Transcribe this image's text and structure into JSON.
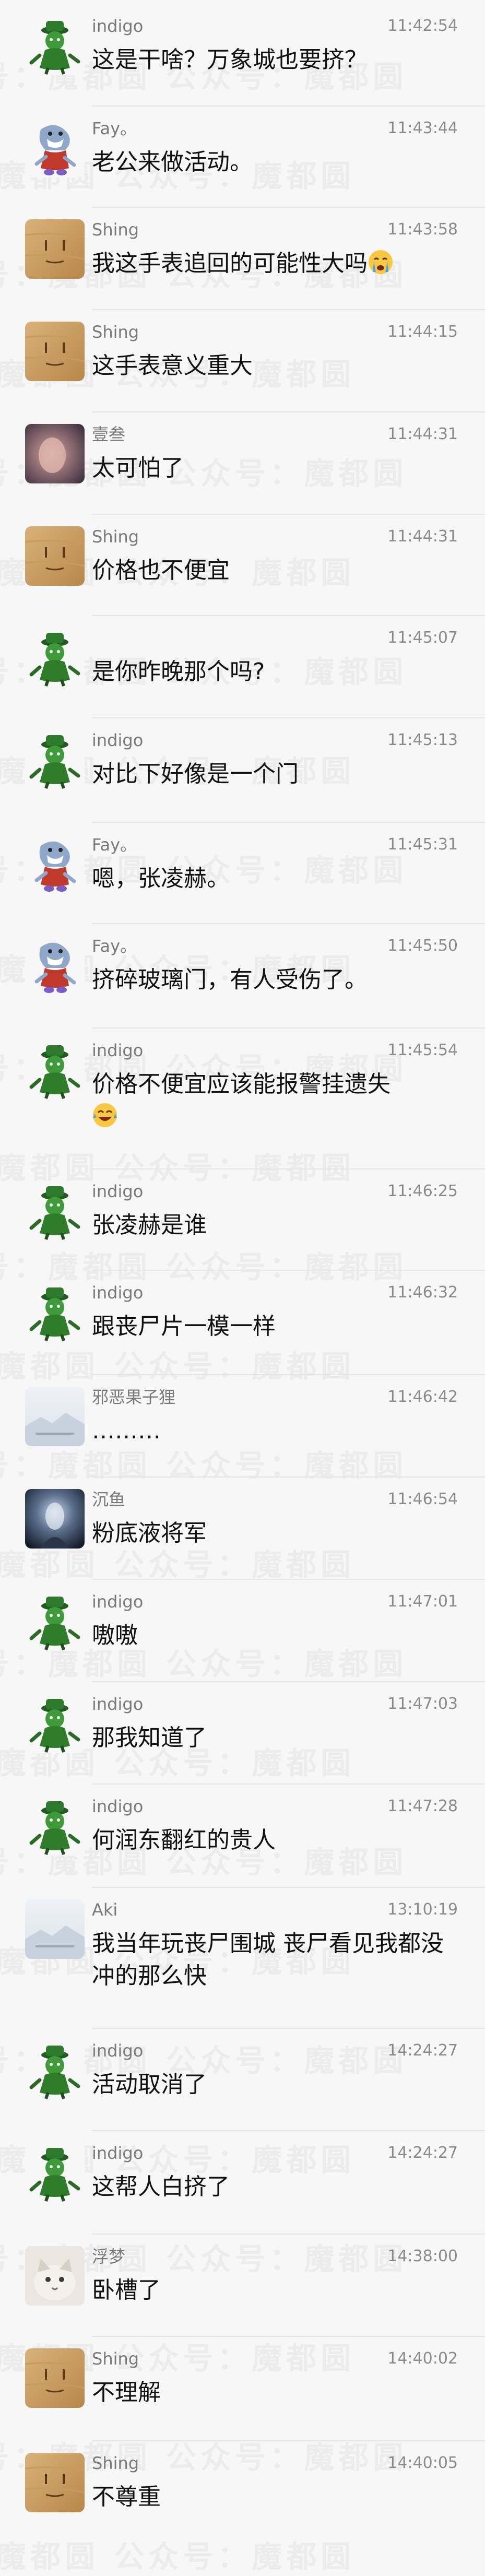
{
  "watermark": "号：魔都圆 公众号：魔都圆",
  "messages": [
    {
      "sender": "indigo",
      "time": "11:42:54",
      "text": "这是干啥？万象城也要挤？",
      "avatar": "green-character-icon"
    },
    {
      "sender": "Fay。",
      "time": "11:43:44",
      "text": "老公来做活动。",
      "avatar": "shark-character-icon"
    },
    {
      "sender": "Shing",
      "time": "11:43:58",
      "text": "我这手表追回的可能性大吗",
      "emoji": "crying-face",
      "avatar": "wooden-face-icon"
    },
    {
      "sender": "Shing",
      "time": "11:44:15",
      "text": "这手表意义重大",
      "avatar": "wooden-face-icon"
    },
    {
      "sender": "壹叁",
      "time": "11:44:31",
      "text": "太可怕了",
      "avatar": "blurred-photo-icon"
    },
    {
      "sender": "Shing",
      "time": "11:44:31",
      "text": "价格也不便宜",
      "avatar": "wooden-face-icon"
    },
    {
      "sender": "",
      "time": "11:45:07",
      "text": "是你昨晚那个吗?",
      "avatar": "green-character-icon"
    },
    {
      "sender": "indigo",
      "time": "11:45:13",
      "text": "对比下好像是一个门",
      "avatar": "green-character-icon"
    },
    {
      "sender": "Fay。",
      "time": "11:45:31",
      "text": "嗯，张凌赫。",
      "avatar": "shark-character-icon"
    },
    {
      "sender": "Fay。",
      "time": "11:45:50",
      "text": "挤碎玻璃门，有人受伤了。",
      "avatar": "shark-character-icon"
    },
    {
      "sender": "indigo",
      "time": "11:45:54",
      "text": "价格不便宜应该能报警挂遗失",
      "emoji": "laughing-face",
      "avatar": "green-character-icon"
    },
    {
      "sender": "indigo",
      "time": "11:46:25",
      "text": "张凌赫是谁",
      "avatar": "green-character-icon"
    },
    {
      "sender": "indigo",
      "time": "11:46:32",
      "text": "跟丧尸片一模一样",
      "avatar": "green-character-icon"
    },
    {
      "sender": "邪恶果子狸",
      "time": "11:46:42",
      "text": "………",
      "avatar": "landscape-photo-icon"
    },
    {
      "sender": "沉鱼",
      "time": "11:46:54",
      "text": "粉底液将军",
      "avatar": "dark-photo-icon"
    },
    {
      "sender": "indigo",
      "time": "11:47:01",
      "text": "嗷嗷",
      "avatar": "green-character-icon"
    },
    {
      "sender": "indigo",
      "time": "11:47:03",
      "text": "那我知道了",
      "avatar": "green-character-icon"
    },
    {
      "sender": "indigo",
      "time": "11:47:28",
      "text": "何润东翻红的贵人",
      "avatar": "green-character-icon"
    },
    {
      "sender": "Aki",
      "time": "13:10:19",
      "text": "我当年玩丧尸围城 丧尸看见我都没冲的那么快",
      "avatar": "landscape-photo-icon"
    },
    {
      "sender": "indigo",
      "time": "14:24:27",
      "text": "活动取消了",
      "avatar": "green-character-icon"
    },
    {
      "sender": "indigo",
      "time": "14:24:27",
      "text": "这帮人白挤了",
      "avatar": "green-character-icon"
    },
    {
      "sender": "浮梦",
      "time": "14:38:00",
      "text": "卧槽了",
      "avatar": "cat-photo-icon"
    },
    {
      "sender": "Shing",
      "time": "14:40:02",
      "text": "不理解",
      "avatar": "wooden-face-icon"
    },
    {
      "sender": "Shing",
      "time": "14:40:05",
      "text": "不尊重",
      "avatar": "wooden-face-icon"
    }
  ]
}
